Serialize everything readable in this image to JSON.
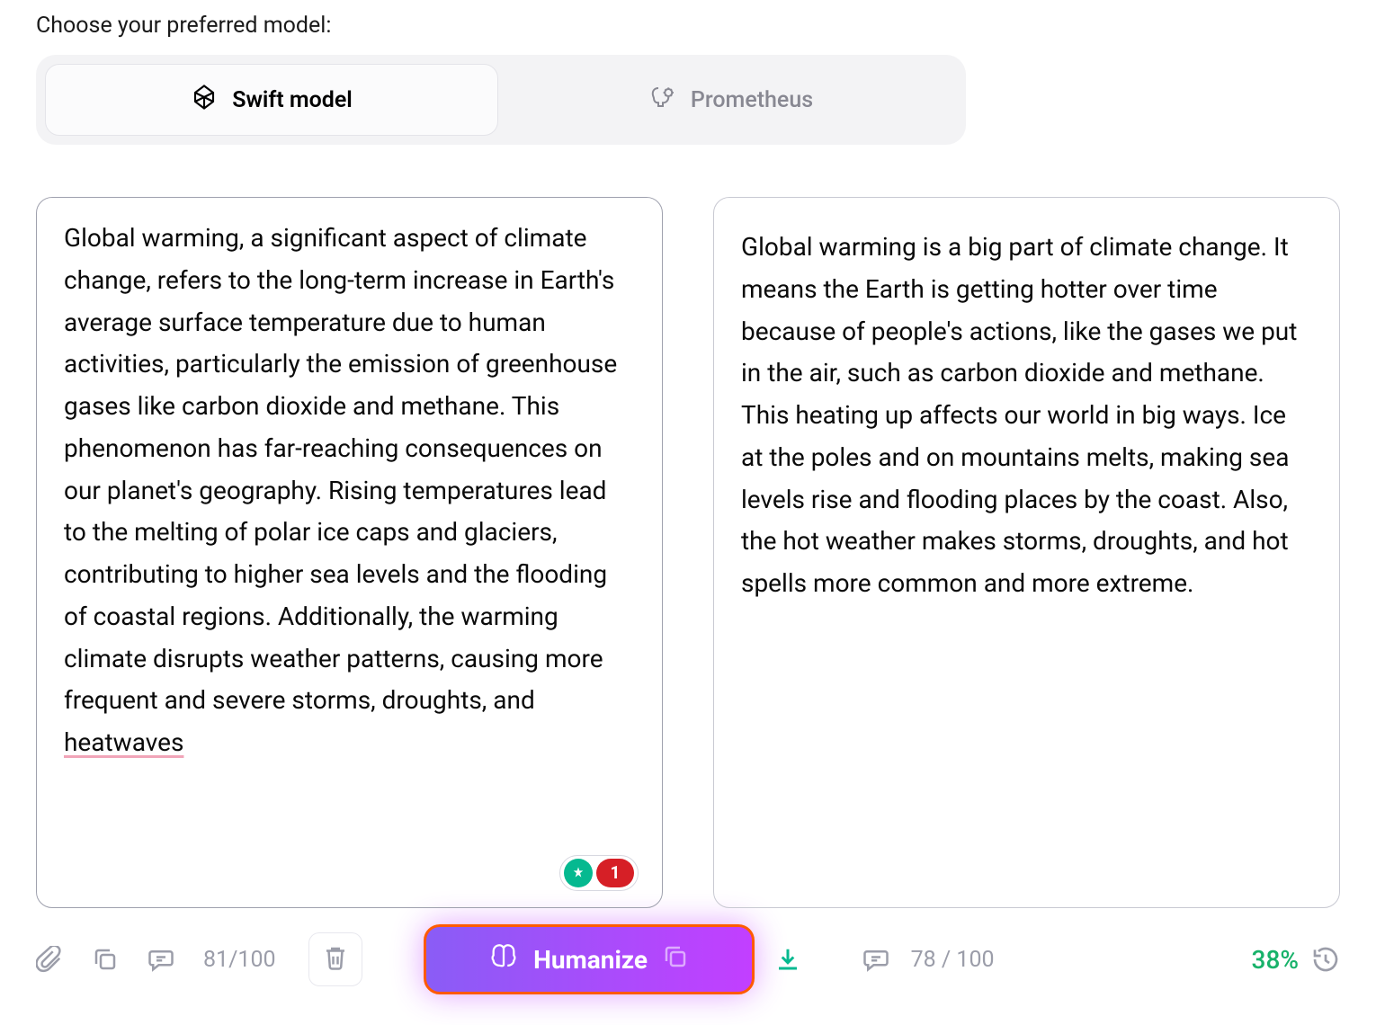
{
  "header": {
    "label": "Choose your preferred model:"
  },
  "models": {
    "tabs": [
      {
        "label": "Swift model",
        "active": true
      },
      {
        "label": "Prometheus",
        "active": false
      }
    ]
  },
  "left_panel": {
    "text_before_underline": "Global warming, a significant aspect of climate change, refers to the long-term increase in Earth's average surface temperature due to human activities, particularly the emission of greenhouse gases like carbon dioxide and methane. This phenomenon has far-reaching consequences on our planet's geography. Rising temperatures lead to the melting of polar ice caps and glaciers, contributing to higher sea levels and the flooding of coastal regions. Additionally, the warming climate disrupts weather patterns, causing more frequent and severe storms, droughts, and ",
    "underlined": "heatwaves",
    "badge": {
      "count": "1"
    }
  },
  "right_panel": {
    "text": "Global warming is a big part of climate change. It means the Earth is getting hotter over time because of people's actions, like the gases we put in the air, such as carbon dioxide and methane. This heating up affects our world in big ways. Ice at the poles and on mountains melts, making sea levels rise and flooding places by the coast. Also, the hot weather makes storms, droughts, and hot spells more common and more extreme."
  },
  "footer": {
    "left_count": "81/100",
    "humanize_label": "Humanize",
    "right_count": "78 / 100",
    "percent": "38%"
  }
}
